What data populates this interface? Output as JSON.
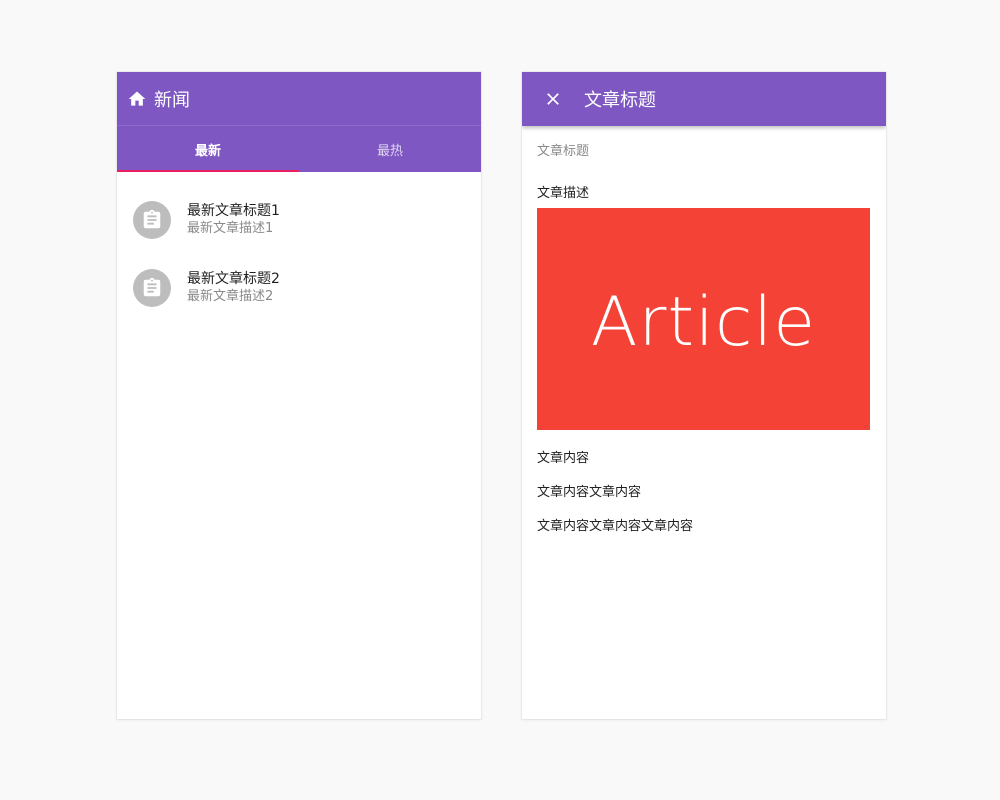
{
  "colors": {
    "primary": "#7e57c2",
    "tab_indicator": "#e91e63",
    "article_image_bg": "#f44336"
  },
  "news_screen": {
    "app_title": "新闻",
    "home_icon": "home-icon",
    "tabs": [
      {
        "label": "最新",
        "active": true
      },
      {
        "label": "最热",
        "active": false
      }
    ],
    "items": [
      {
        "title": "最新文章标题1",
        "desc": "最新文章描述1",
        "icon": "clipboard-icon"
      },
      {
        "title": "最新文章标题2",
        "desc": "最新文章描述2",
        "icon": "clipboard-icon"
      }
    ]
  },
  "article_screen": {
    "app_title": "文章标题",
    "close_icon": "close-icon",
    "title_small": "文章标题",
    "description": "文章描述",
    "image_text": "Article",
    "paragraphs": [
      "文章内容",
      "文章内容文章内容",
      "文章内容文章内容文章内容"
    ]
  }
}
